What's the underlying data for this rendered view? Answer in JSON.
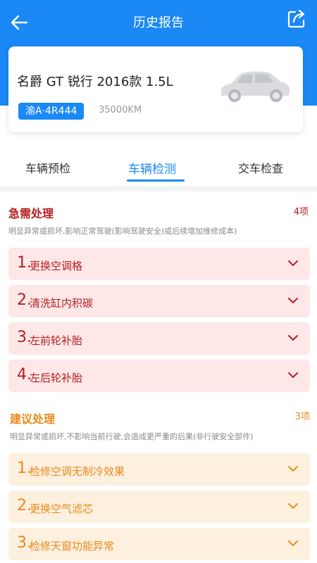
{
  "header": {
    "title": "历史报告"
  },
  "car": {
    "name": "名爵 GT 锐行 2016款 1.5L",
    "plate": "渝A·4R444",
    "mileage": "35000KM"
  },
  "tabs": [
    {
      "label": "车辆预检"
    },
    {
      "label": "车辆检测"
    },
    {
      "label": "交车检查"
    }
  ],
  "urgent": {
    "title": "急需处理",
    "count": "4项",
    "desc": "明显异常或损坏,影响正常驾驶(影响驾驶安全)或后续增加维修成本)",
    "items": [
      {
        "num": "1.",
        "label": "更换空调格"
      },
      {
        "num": "2.",
        "label": "清洗缸内积碳"
      },
      {
        "num": "3.",
        "label": "左前轮补胎"
      },
      {
        "num": "4.",
        "label": "左后轮补胎"
      }
    ]
  },
  "suggest": {
    "title": "建议处理",
    "count": "3项",
    "desc": "明显异常或损坏,不影响当前行驶,会造成更严重的后果(非行驶安全部件)",
    "items": [
      {
        "num": "1.",
        "label": "检修空调无制冷效果"
      },
      {
        "num": "2.",
        "label": "更换空气滤芯"
      },
      {
        "num": "3.",
        "label": "检修天窗功能异常"
      }
    ]
  },
  "colors": {
    "primary": "#1a88f5",
    "urgent": "#b41f22",
    "suggest": "#e98a1b"
  }
}
